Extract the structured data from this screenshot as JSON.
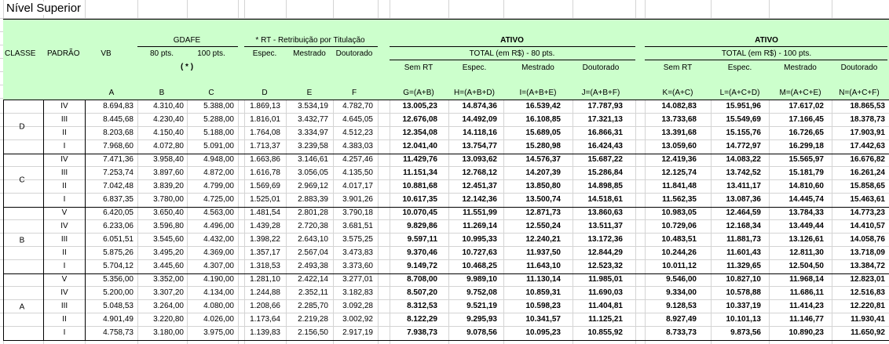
{
  "title": "Nível Superior",
  "header": {
    "classe": "CLASSE",
    "padrao": "PADRÃO",
    "vb": "VB",
    "gdafe": "GDAFE",
    "gdafe_80": "80 pts.",
    "gdafe_100": "100 pts.",
    "gdafe_note": "( * )",
    "rt": "* RT - Retribuição por Titulação",
    "rt_espec": "Espec.",
    "rt_mestrado": "Mestrado",
    "rt_doutorado": "Doutorado",
    "ativo_80": "ATIVO",
    "total_80": "TOTAL (em R$) - 80 pts.",
    "ativo_100": "ATIVO",
    "total_100": "TOTAL (em R$) - 100 pts.",
    "sub80": [
      "Sem RT",
      "Espec.",
      "Mestrado",
      "Doutorado"
    ],
    "sub100": [
      "Sem RT",
      "Espec.",
      "Mestrado",
      "Doutorado"
    ],
    "letters": [
      "A",
      "B",
      "C",
      "D",
      "E",
      "F",
      "G=(A+B)",
      "H=(A+B+D)",
      "I=(A+B+E)",
      "J=(A+B+F)",
      "K=(A+C)",
      "L=(A+C+D)",
      "M=(A+C+E)",
      "N=(A+C+F)"
    ]
  },
  "groups": [
    {
      "classe": "D",
      "rows": [
        {
          "padrao": "IV",
          "vals": [
            "8.694,83",
            "4.310,40",
            "5.388,00",
            "1.869,13",
            "3.534,19",
            "4.782,70",
            "13.005,23",
            "14.874,36",
            "16.539,42",
            "17.787,93",
            "14.082,83",
            "15.951,96",
            "17.617,02",
            "18.865,53"
          ]
        },
        {
          "padrao": "III",
          "vals": [
            "8.445,68",
            "4.230,40",
            "5.288,00",
            "1.816,01",
            "3.432,77",
            "4.645,05",
            "12.676,08",
            "14.492,09",
            "16.108,85",
            "17.321,13",
            "13.733,68",
            "15.549,69",
            "17.166,45",
            "18.378,73"
          ]
        },
        {
          "padrao": "II",
          "vals": [
            "8.203,68",
            "4.150,40",
            "5.188,00",
            "1.764,08",
            "3.334,97",
            "4.512,23",
            "12.354,08",
            "14.118,16",
            "15.689,05",
            "16.866,31",
            "13.391,68",
            "15.155,76",
            "16.726,65",
            "17.903,91"
          ]
        },
        {
          "padrao": "I",
          "vals": [
            "7.968,60",
            "4.072,80",
            "5.091,00",
            "1.713,37",
            "3.239,58",
            "4.383,03",
            "12.041,40",
            "13.754,77",
            "15.280,98",
            "16.424,43",
            "13.059,60",
            "14.772,97",
            "16.299,18",
            "17.442,63"
          ]
        }
      ]
    },
    {
      "classe": "C",
      "rows": [
        {
          "padrao": "IV",
          "vals": [
            "7.471,36",
            "3.958,40",
            "4.948,00",
            "1.663,86",
            "3.146,61",
            "4.257,46",
            "11.429,76",
            "13.093,62",
            "14.576,37",
            "15.687,22",
            "12.419,36",
            "14.083,22",
            "15.565,97",
            "16.676,82"
          ]
        },
        {
          "padrao": "III",
          "vals": [
            "7.253,74",
            "3.897,60",
            "4.872,00",
            "1.616,78",
            "3.056,05",
            "4.135,50",
            "11.151,34",
            "12.768,12",
            "14.207,39",
            "15.286,84",
            "12.125,74",
            "13.742,52",
            "15.181,79",
            "16.261,24"
          ]
        },
        {
          "padrao": "II",
          "vals": [
            "7.042,48",
            "3.839,20",
            "4.799,00",
            "1.569,69",
            "2.969,12",
            "4.017,17",
            "10.881,68",
            "12.451,37",
            "13.850,80",
            "14.898,85",
            "11.841,48",
            "13.411,17",
            "14.810,60",
            "15.858,65"
          ]
        },
        {
          "padrao": "I",
          "vals": [
            "6.837,35",
            "3.780,00",
            "4.725,00",
            "1.525,01",
            "2.883,39",
            "3.901,26",
            "10.617,35",
            "12.142,36",
            "13.500,74",
            "14.518,61",
            "11.562,35",
            "13.087,36",
            "14.445,74",
            "15.463,61"
          ]
        }
      ]
    },
    {
      "classe": "B",
      "rows": [
        {
          "padrao": "V",
          "vals": [
            "6.420,05",
            "3.650,40",
            "4.563,00",
            "1.481,54",
            "2.801,28",
            "3.790,18",
            "10.070,45",
            "11.551,99",
            "12.871,73",
            "13.860,63",
            "10.983,05",
            "12.464,59",
            "13.784,33",
            "14.773,23"
          ]
        },
        {
          "padrao": "IV",
          "vals": [
            "6.233,06",
            "3.596,80",
            "4.496,00",
            "1.439,28",
            "2.720,38",
            "3.681,51",
            "9.829,86",
            "11.269,14",
            "12.550,24",
            "13.511,37",
            "10.729,06",
            "12.168,34",
            "13.449,44",
            "14.410,57"
          ]
        },
        {
          "padrao": "III",
          "vals": [
            "6.051,51",
            "3.545,60",
            "4.432,00",
            "1.398,22",
            "2.643,10",
            "3.575,25",
            "9.597,11",
            "10.995,33",
            "12.240,21",
            "13.172,36",
            "10.483,51",
            "11.881,73",
            "13.126,61",
            "14.058,76"
          ]
        },
        {
          "padrao": "II",
          "vals": [
            "5.875,26",
            "3.495,20",
            "4.369,00",
            "1.357,17",
            "2.567,04",
            "3.473,83",
            "9.370,46",
            "10.727,63",
            "11.937,50",
            "12.844,29",
            "10.244,26",
            "11.601,43",
            "12.811,30",
            "13.718,09"
          ]
        },
        {
          "padrao": "I",
          "vals": [
            "5.704,12",
            "3.445,60",
            "4.307,00",
            "1.318,53",
            "2.493,38",
            "3.373,60",
            "9.149,72",
            "10.468,25",
            "11.643,10",
            "12.523,32",
            "10.011,12",
            "11.329,65",
            "12.504,50",
            "13.384,72"
          ]
        }
      ]
    },
    {
      "classe": "A",
      "rows": [
        {
          "padrao": "V",
          "vals": [
            "5.356,00",
            "3.352,00",
            "4.190,00",
            "1.281,10",
            "2.422,14",
            "3.277,01",
            "8.708,00",
            "9.989,10",
            "11.130,14",
            "11.985,01",
            "9.546,00",
            "10.827,10",
            "11.968,14",
            "12.823,01"
          ]
        },
        {
          "padrao": "IV",
          "vals": [
            "5.200,00",
            "3.307,20",
            "4.134,00",
            "1.244,88",
            "2.352,11",
            "3.182,83",
            "8.507,20",
            "9.752,08",
            "10.859,31",
            "11.690,03",
            "9.334,00",
            "10.578,88",
            "11.686,11",
            "12.516,83"
          ]
        },
        {
          "padrao": "III",
          "vals": [
            "5.048,53",
            "3.264,00",
            "4.080,00",
            "1.208,66",
            "2.285,70",
            "3.092,28",
            "8.312,53",
            "9.521,19",
            "10.598,23",
            "11.404,81",
            "9.128,53",
            "10.337,19",
            "11.414,23",
            "12.220,81"
          ]
        },
        {
          "padrao": "II",
          "vals": [
            "4.901,49",
            "3.220,80",
            "4.026,00",
            "1.173,64",
            "2.219,28",
            "3.002,92",
            "8.122,29",
            "9.295,93",
            "10.341,57",
            "11.125,21",
            "8.927,49",
            "10.101,13",
            "11.146,77",
            "11.930,41"
          ]
        },
        {
          "padrao": "I",
          "vals": [
            "4.758,73",
            "3.180,00",
            "3.975,00",
            "1.139,83",
            "2.156,50",
            "2.917,19",
            "7.938,73",
            "9.078,56",
            "10.095,23",
            "10.855,92",
            "8.733,73",
            "9.873,56",
            "10.890,23",
            "11.650,92"
          ]
        }
      ]
    }
  ]
}
